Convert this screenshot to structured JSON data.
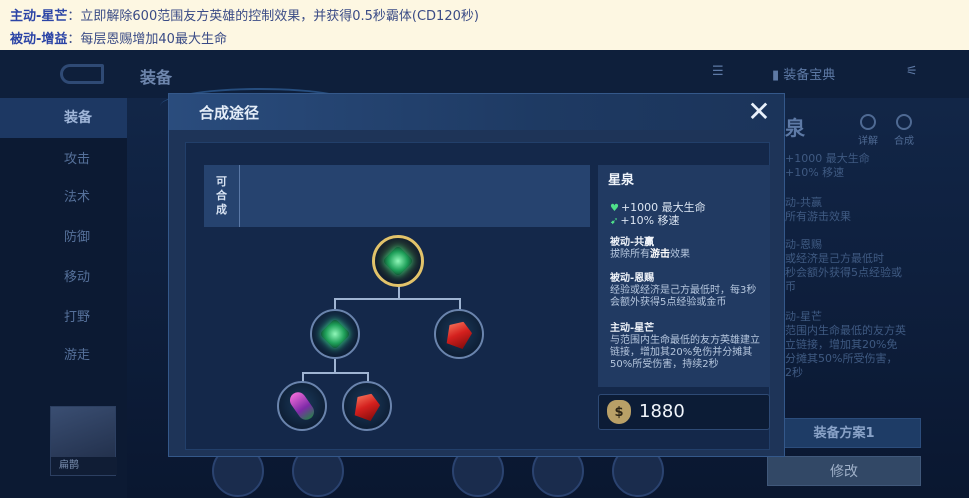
{
  "info": {
    "active": {
      "key": "主动-星芒",
      "value": "：立即解除600范围友方英雄的控制效果，并获得0.5秒霸体(CD120秒)"
    },
    "passive": {
      "key": "被动-增益",
      "value": "：每层恩赐增加40最大生命"
    }
  },
  "background": {
    "title": "装备",
    "sidebar": [
      "装备",
      "攻击",
      "法术",
      "防御",
      "移动",
      "打野",
      "游走"
    ],
    "right_title": "泉",
    "right_tools": {
      "manual": "装备宝典",
      "detail": "详解",
      "combine": "合成"
    },
    "right_lines": [
      "+1000 最大生命",
      "+10% 移速",
      "动-共赢",
      "所有游击效果",
      "动-恩赐",
      "或经济是己方最低时",
      "秒会额外获得5点经验或",
      "币",
      "动-星芒",
      "范围内生命最低的友方英",
      "立链接，增加其20%免",
      "分摊其50%所受伤害，",
      "2秒"
    ],
    "hero_name": "扁鹊",
    "plan_button": "装备方案1",
    "modify_button": "修改"
  },
  "modal": {
    "title": "合成途径",
    "combine_label": "可合成",
    "item": {
      "name": "星泉",
      "stats": [
        "+1000 最大生命",
        "+10% 移速"
      ],
      "passives": [
        {
          "title": "被动-共赢",
          "pre": "拔除所有",
          "hl": "游击",
          "post": "效果"
        },
        {
          "title": "被动-恩赐",
          "pre": "经验或经济是己方最低时，每3秒会额外获得5点经验或金币",
          "hl": "",
          "post": ""
        },
        {
          "title": "主动-星芒",
          "pre": "与范围内生命最低的友方英雄建立链接，增加其20%免伤并分摊其50%所受伤害，持续2秒",
          "hl": "",
          "post": ""
        }
      ],
      "price": "1880"
    },
    "tree": {
      "root": {
        "name": "星泉",
        "gem": "green"
      },
      "level1": [
        {
          "name": "green-gem-component",
          "gem": "green"
        },
        {
          "name": "red-crystal",
          "gem": "red"
        }
      ],
      "level2": [
        {
          "name": "purple-green-crystal",
          "gem": "purple"
        },
        {
          "name": "red-crystal",
          "gem": "red"
        }
      ]
    }
  }
}
